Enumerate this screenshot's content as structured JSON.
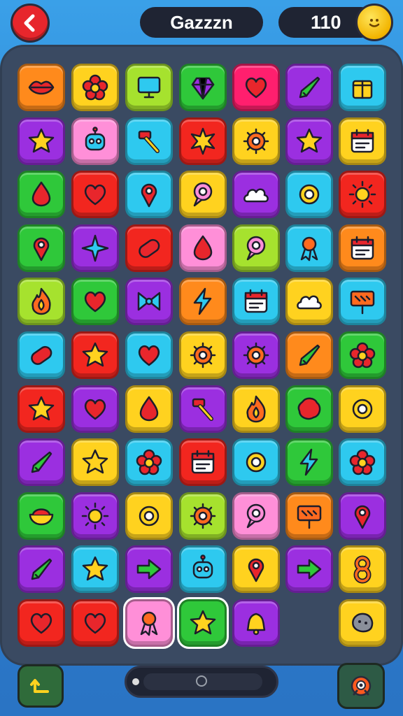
{
  "header": {
    "player_name": "Gazzzn",
    "coins": "110"
  },
  "palette": {
    "orange": "#ff8a1c",
    "yellow": "#ffd21f",
    "lime": "#a6e22e",
    "green": "#2fc83a",
    "magenta": "#ff1f6e",
    "purple": "#9b2fe0",
    "cyan": "#2ec9ef",
    "pink": "#ff8fd8",
    "red": "#f2261f"
  },
  "board": {
    "rows": [
      [
        {
          "color": "orange",
          "icon": "lips-icon"
        },
        {
          "color": "yellow",
          "icon": "flower-icon"
        },
        {
          "color": "lime",
          "icon": "monitor-icon"
        },
        {
          "color": "green",
          "icon": "gem-icon"
        },
        {
          "color": "magenta",
          "icon": "heart-icon"
        },
        {
          "color": "purple",
          "icon": "pen-icon"
        },
        {
          "color": "cyan",
          "icon": "box-icon"
        }
      ],
      [
        {
          "color": "purple",
          "icon": "star-icon"
        },
        {
          "color": "pink",
          "icon": "robot-icon"
        },
        {
          "color": "cyan",
          "icon": "hammer-icon"
        },
        {
          "color": "red",
          "icon": "burst-icon"
        },
        {
          "color": "yellow",
          "icon": "gear-icon"
        },
        {
          "color": "purple",
          "icon": "star-icon"
        },
        {
          "color": "yellow",
          "icon": "calendar-icon"
        }
      ],
      [
        {
          "color": "green",
          "icon": "drop-icon"
        },
        {
          "color": "red",
          "icon": "heart-icon"
        },
        {
          "color": "cyan",
          "icon": "pin-icon"
        },
        {
          "color": "yellow",
          "icon": "bubble-icon"
        },
        {
          "color": "purple",
          "icon": "cloud-icon"
        },
        {
          "color": "cyan",
          "icon": "ring-icon"
        },
        {
          "color": "red",
          "icon": "sun-icon"
        }
      ],
      [
        {
          "color": "green",
          "icon": "pin-icon"
        },
        {
          "color": "purple",
          "icon": "sparkle-icon"
        },
        {
          "color": "red",
          "icon": "capsule-icon"
        },
        {
          "color": "pink",
          "icon": "drop-icon"
        },
        {
          "color": "lime",
          "icon": "bubble-icon"
        },
        {
          "color": "cyan",
          "icon": "ribbon-icon"
        },
        {
          "color": "orange",
          "icon": "calendar-icon"
        }
      ],
      [
        {
          "color": "lime",
          "icon": "flame-icon"
        },
        {
          "color": "green",
          "icon": "heart-icon"
        },
        {
          "color": "purple",
          "icon": "bow-icon"
        },
        {
          "color": "orange",
          "icon": "bolt-icon"
        },
        {
          "color": "cyan",
          "icon": "calendar-icon"
        },
        {
          "color": "yellow",
          "icon": "cloud-icon"
        },
        {
          "color": "cyan",
          "icon": "sign-icon"
        }
      ],
      [
        {
          "color": "cyan",
          "icon": "capsule-icon"
        },
        {
          "color": "red",
          "icon": "star-icon"
        },
        {
          "color": "cyan",
          "icon": "heart-icon"
        },
        {
          "color": "yellow",
          "icon": "gear-icon"
        },
        {
          "color": "purple",
          "icon": "gear-icon"
        },
        {
          "color": "orange",
          "icon": "pen-icon"
        },
        {
          "color": "green",
          "icon": "flower-icon"
        }
      ],
      [
        {
          "color": "red",
          "icon": "star-icon"
        },
        {
          "color": "purple",
          "icon": "heart-icon"
        },
        {
          "color": "yellow",
          "icon": "drop-icon"
        },
        {
          "color": "purple",
          "icon": "hammer-icon"
        },
        {
          "color": "yellow",
          "icon": "flame-icon"
        },
        {
          "color": "green",
          "icon": "blob-icon"
        },
        {
          "color": "yellow",
          "icon": "ring-icon"
        }
      ],
      [
        {
          "color": "purple",
          "icon": "pen-icon"
        },
        {
          "color": "yellow",
          "icon": "star-icon"
        },
        {
          "color": "cyan",
          "icon": "flower-icon"
        },
        {
          "color": "red",
          "icon": "calendar-icon"
        },
        {
          "color": "cyan",
          "icon": "ring-icon"
        },
        {
          "color": "green",
          "icon": "bolt-icon"
        },
        {
          "color": "cyan",
          "icon": "flower-icon"
        }
      ],
      [
        {
          "color": "green",
          "icon": "bowl-icon"
        },
        {
          "color": "purple",
          "icon": "sun-icon"
        },
        {
          "color": "yellow",
          "icon": "ring-icon"
        },
        {
          "color": "lime",
          "icon": "gear-icon"
        },
        {
          "color": "pink",
          "icon": "bubble-icon"
        },
        {
          "color": "orange",
          "icon": "sign-icon"
        },
        {
          "color": "purple",
          "icon": "pin-icon"
        }
      ],
      [
        {
          "color": "purple",
          "icon": "pen-icon"
        },
        {
          "color": "cyan",
          "icon": "star-icon"
        },
        {
          "color": "purple",
          "icon": "arrow-right-icon"
        },
        {
          "color": "cyan",
          "icon": "robot-icon"
        },
        {
          "color": "yellow",
          "icon": "pin-icon"
        },
        {
          "color": "purple",
          "icon": "arrow-right-icon"
        },
        {
          "color": "yellow",
          "icon": "eight-icon"
        }
      ],
      [
        {
          "color": "red",
          "icon": "heart-icon"
        },
        {
          "color": "red",
          "icon": "heart-icon"
        },
        {
          "color": "pink",
          "icon": "ribbon-icon"
        },
        {
          "color": "green",
          "icon": "star-icon"
        },
        {
          "color": "purple",
          "icon": "bell-icon"
        },
        null,
        {
          "color": "yellow",
          "icon": "rock-icon"
        }
      ]
    ]
  },
  "controls": {
    "undo_icon": "undo-arrow-icon",
    "hint_icon": "mascot-icon"
  }
}
